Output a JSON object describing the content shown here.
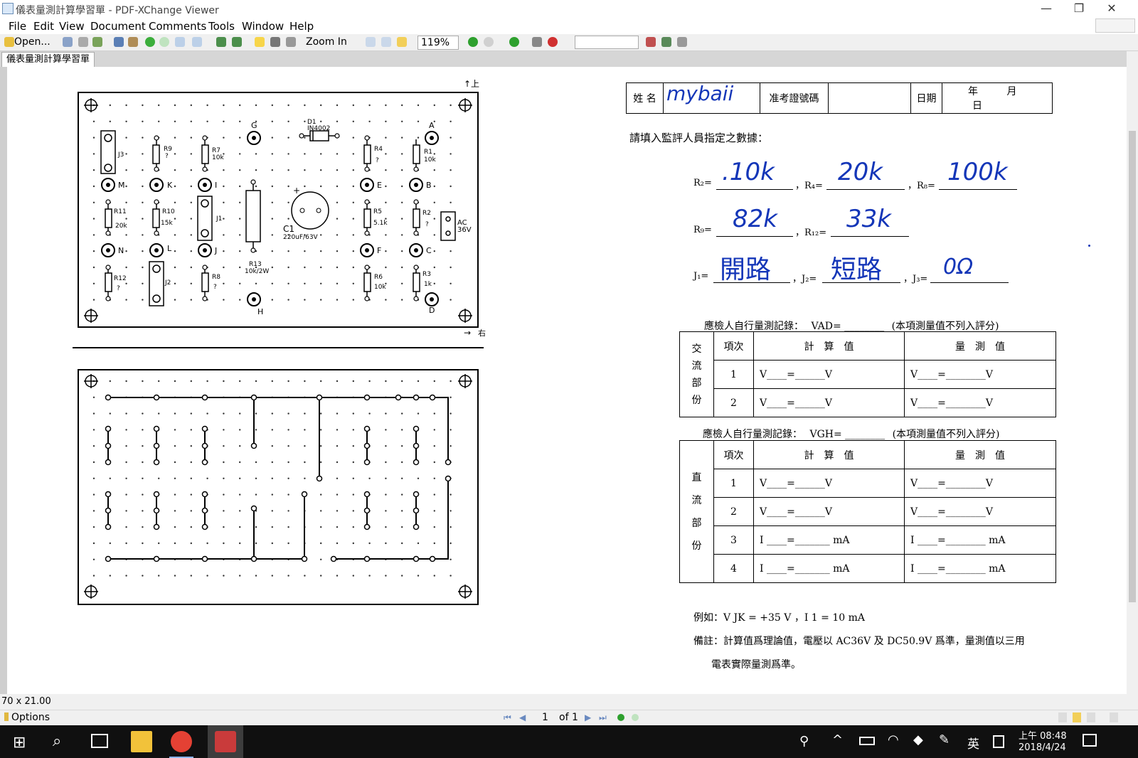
{
  "window": {
    "title": "儀表量測計算學習單 - PDF-XChange Viewer",
    "min": "—",
    "restore": "❐",
    "close": "✕"
  },
  "menu": [
    "File",
    "Edit",
    "View",
    "Document",
    "Comments",
    "Tools",
    "Window",
    "Help"
  ],
  "toolbar": {
    "open_label": "Open...",
    "zoom_in_label": "Zoom In",
    "zoom_value": "119%"
  },
  "tab": {
    "label": "儀表量測計算學習單"
  },
  "status": {
    "page_size": "70 x 21.00",
    "options_label": "Options",
    "page_current": "1",
    "page_total": "of 1"
  },
  "taskbar": {
    "ime": "英",
    "time": "上午 08:48",
    "date": "2018/4/24"
  },
  "board": {
    "top_arrow": "上",
    "right_arrow": "右",
    "terminals": [
      "G",
      "A",
      "M",
      "K",
      "I",
      "E",
      "B",
      "N",
      "L",
      "J",
      "F",
      "C",
      "H",
      "D"
    ],
    "components": [
      {
        "name": "J3",
        "value": ""
      },
      {
        "name": "R9",
        "value": "?"
      },
      {
        "name": "R7",
        "value": "10k"
      },
      {
        "name": "D1",
        "value": "IN4002"
      },
      {
        "name": "R4",
        "value": "?"
      },
      {
        "name": "R1",
        "value": "10k"
      },
      {
        "name": "R11",
        "value": "20k"
      },
      {
        "name": "R10",
        "value": "15k"
      },
      {
        "name": "J1",
        "value": ""
      },
      {
        "name": "C1",
        "value": "220uF/63V"
      },
      {
        "name": "R5",
        "value": "5.1k"
      },
      {
        "name": "R2",
        "value": "?"
      },
      {
        "name": "R12",
        "value": "?"
      },
      {
        "name": "J2",
        "value": ""
      },
      {
        "name": "R8",
        "value": "?"
      },
      {
        "name": "R13",
        "value": "10k/2W"
      },
      {
        "name": "R6",
        "value": "10k"
      },
      {
        "name": "R3",
        "value": "1k"
      }
    ],
    "ac_label": "AC",
    "ac_value": "36V",
    "plus_sign": "+"
  },
  "form": {
    "name_label": "姓 名",
    "name_value": "mybaii",
    "exam_label": "准考證號碼",
    "date_label": "日期",
    "year": "年",
    "month": "月",
    "day": "日",
    "instruction": "請填入監評人員指定之數據：",
    "rows": [
      [
        {
          "label": "R₂=",
          "value": ".10k"
        },
        {
          "label": "，R₄=",
          "value": "20k"
        },
        {
          "label": "，R₈=",
          "value": "100k"
        }
      ],
      [
        {
          "label": "R₉=",
          "value": "82k"
        },
        {
          "label": "，R₁₂=",
          "value": "33k"
        }
      ],
      [
        {
          "label": "J₁=",
          "value": "開路"
        },
        {
          "label": "，J₂=",
          "value": "短路"
        },
        {
          "label": "，J₃=",
          "value": "0Ω"
        }
      ]
    ],
    "ac_section": {
      "heading_left": "應檢人自行量測記錄：",
      "heading_var": "VAD=",
      "heading_blank": "________",
      "heading_right": "(本項測量值不列入評分)",
      "side": [
        "交",
        "流",
        "部",
        "份"
      ],
      "col_item": "項次",
      "col_calc": "計　算　值",
      "col_meas": "量　測　值",
      "rows": [
        {
          "n": "1",
          "calc": "V____=______V",
          "meas": "V____=________V"
        },
        {
          "n": "2",
          "calc": "V____=______V",
          "meas": "V____=________V"
        }
      ]
    },
    "dc_section": {
      "heading_left": "應檢人自行量測記錄：",
      "heading_var": "VGH=",
      "heading_blank": "________",
      "heading_right": "(本項測量值不列入評分)",
      "side": [
        "直",
        "流",
        "部",
        "份"
      ],
      "col_item": "項次",
      "col_calc": "計　算　值",
      "col_meas": "量　測　值",
      "rows": [
        {
          "n": "1",
          "calc": "V____=______V",
          "meas": "V____=________V"
        },
        {
          "n": "2",
          "calc": "V____=______V",
          "meas": "V____=________V"
        },
        {
          "n": "3",
          "calc": "I ____=_______ mA",
          "meas": "I ____=________ mA"
        },
        {
          "n": "4",
          "calc": "I ____=_______ mA",
          "meas": "I ____=________ mA"
        }
      ]
    },
    "example": "例如：V JK = +35 V ，I 1 = 10 mA",
    "note_line1": "備註：計算值爲理論值，電壓以 AC36V 及 DC50.9V 爲準，量測值以三用",
    "note_line2": "電表實際量測爲準。"
  }
}
